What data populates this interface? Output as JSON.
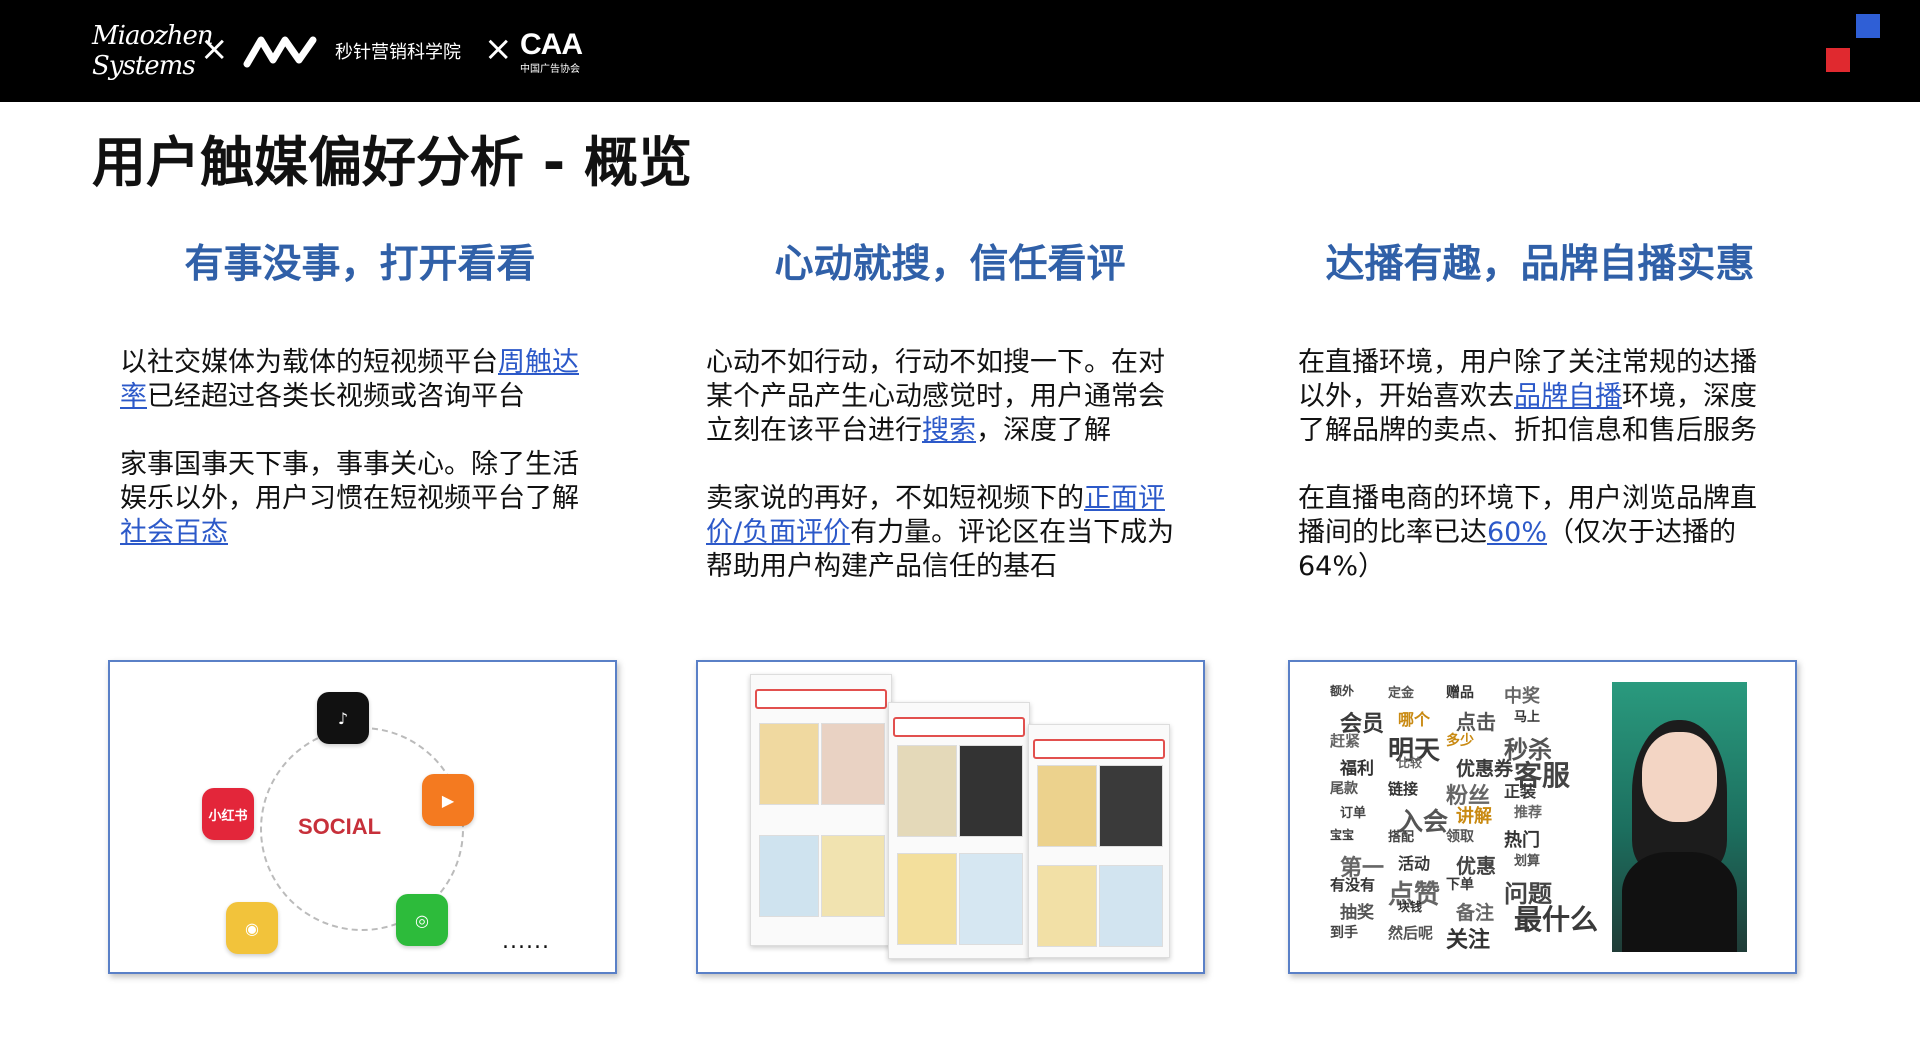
{
  "header": {
    "logo_miaozhen_line1": "Miaozhen",
    "logo_miaozhen_line2": "Systems",
    "times_symbol": "×",
    "school_name": "秒针营销科学院",
    "caa_mark": "CAA",
    "caa_subtitle": "中国广告协会"
  },
  "title": "用户触媒偏好分析 - 概览",
  "columns": [
    {
      "heading": "有事没事，打开看看",
      "p1_before": "以社交媒体为载体的短视频平台",
      "p1_link": "周触达率",
      "p1_after": "已经超过各类长视频或咨询平台",
      "p2_before": "家事国事天下事，事事关心。除了生活娱乐以外，用户习惯在短视频平台了解",
      "p2_link": "社会百态",
      "p2_after": ""
    },
    {
      "heading": "心动就搜，信任看评",
      "p1_before": "心动不如行动，行动不如搜一下。在对某个产品产生心动感觉时，用户通常会立刻在该平台进行",
      "p1_link": "搜索",
      "p1_after": "，深度了解",
      "p2_before": "卖家说的再好，不如短视频下的",
      "p2_link": "正面评价/负面评价",
      "p2_after": "有力量。评论区在当下成为帮助用户构建产品信任的基石"
    },
    {
      "heading": "达播有趣，品牌自播实惠",
      "p1_before": "在直播环境，用户除了关注常规的达播以外，开始喜欢去",
      "p1_link": "品牌自播",
      "p1_after": "环境，深度了解品牌的卖点、折扣信息和售后服务",
      "p2_before": "在直播电商的环境下，用户浏览品牌直播间的比率已达",
      "p2_link": "60%",
      "p2_after": "（仅次于达播的64%）"
    }
  ],
  "social_panel": {
    "center_label": "SOCIAL",
    "apps": [
      {
        "name": "tiktok-icon",
        "label": "♪",
        "color": "#111111"
      },
      {
        "name": "kuaishou-icon",
        "label": "▶",
        "color": "#f47a20"
      },
      {
        "name": "wechat-icon",
        "label": "◎",
        "color": "#2dbb3b"
      },
      {
        "name": "weibo-icon",
        "label": "◉",
        "color": "#f2c33b"
      },
      {
        "name": "xiaohongshu-icon",
        "label": "小红书",
        "color": "#e3263a"
      }
    ],
    "more": "......"
  },
  "wordcloud_panel": {
    "words": [
      "额外",
      "定金",
      "赠品",
      "中奖",
      "会员",
      "哪个",
      "点击",
      "马上",
      "赶紧",
      "明天",
      "多少",
      "秒杀",
      "福利",
      "比较",
      "优惠券",
      "客服",
      "尾款",
      "链接",
      "粉丝",
      "正装",
      "订单",
      "入会",
      "讲解",
      "推荐",
      "宝宝",
      "搭配",
      "领取",
      "热门",
      "第一",
      "活动",
      "优惠",
      "划算",
      "有没有",
      "点赞",
      "下单",
      "问题",
      "抽奖",
      "块钱",
      "备注",
      "最什么",
      "到手",
      "然后呢",
      "关注"
    ]
  }
}
